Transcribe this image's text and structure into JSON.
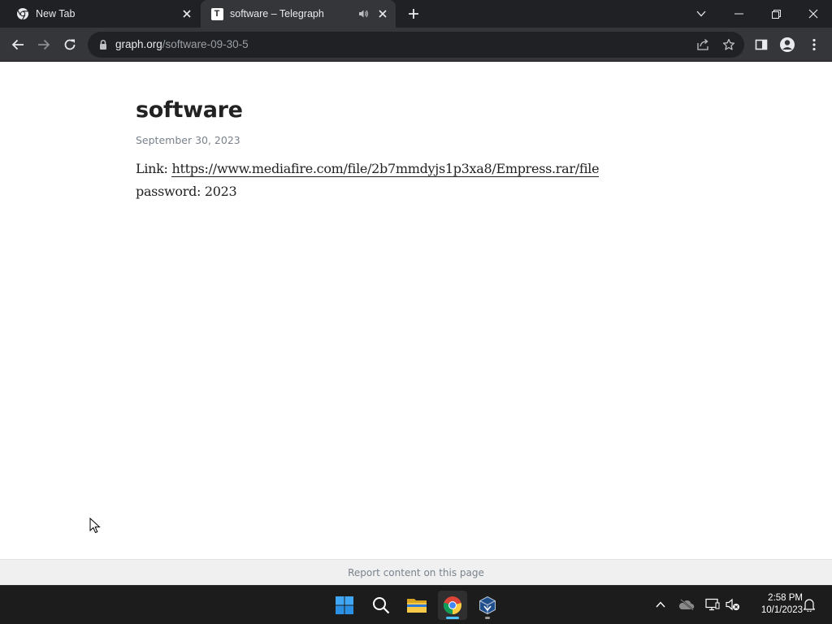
{
  "browser": {
    "tabs": [
      {
        "title": "New Tab",
        "favicon": "chrome-icon",
        "active": false
      },
      {
        "title": "software – Telegraph",
        "favicon": "telegraph-icon",
        "favicon_letter": "T",
        "active": true,
        "audio": true
      }
    ],
    "address": {
      "host": "graph.org",
      "path": "/software-09-30-5"
    }
  },
  "article": {
    "title": "software",
    "date": "September 30, 2023",
    "link_label": "Link:",
    "link_url": "https://www.mediafire.com/file/2b7mmdyjs1p3xa8/Empress.rar/file",
    "password_line": "password: 2023"
  },
  "footer": {
    "report_text": "Report content on this page"
  },
  "taskbar": {
    "time": "2:58 PM",
    "date": "10/1/2023",
    "apps": [
      "start-icon",
      "search-icon",
      "file-explorer-icon",
      "chrome-icon",
      "virtualbox-icon"
    ]
  },
  "colors": {
    "titlebar": "#202124",
    "toolbar": "#35363a",
    "taskbar": "#1c1c1c",
    "text": "#222222",
    "muted": "#79828b"
  }
}
